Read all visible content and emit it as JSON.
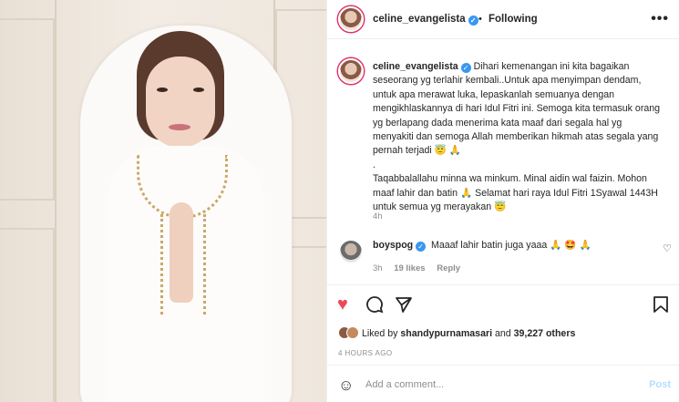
{
  "header": {
    "username": "celine_evangelista",
    "separator": "•",
    "follow_state": "Following",
    "more": "•••"
  },
  "caption": {
    "username": "celine_evangelista",
    "lines": [
      "Dihari kemenangan ini kita bagaikan",
      "seseorang yg terlahir kembali..Untuk apa menyimpan dendam,",
      "untuk apa merawat luka, lepaskanlah semuanya dengan",
      "mengikhlaskannya di hari Idul Fitri ini. Semoga kita termasuk orang",
      "yg berlapang dada menerima kata maaf dari segala hal yg",
      "menyakiti dan semoga Allah memberikan hikmah atas segala yang",
      "pernah terjadi 😇 🙏",
      ".",
      "Taqabbalallahu minna wa minkum. Minal aidin wal faizin. Mohon",
      "maaf lahir dan batin 🙏 Selamat hari raya Idul Fitri 1Syawal 1443H",
      "untuk semua yg merayakan 😇"
    ],
    "time": "4h"
  },
  "comment": {
    "username": "boyspog",
    "text": "Maaaf lahir batin juga yaaa 🙏 🤩 🙏",
    "time": "3h",
    "likes": "19 likes",
    "reply": "Reply"
  },
  "actions": {
    "liked_prefix": "Liked by ",
    "liked_user": "shandypurnamasari",
    "liked_mid": " and ",
    "liked_count": "39,227 others",
    "timestamp": "4 HOURS AGO"
  },
  "add_comment": {
    "placeholder": "Add a comment...",
    "post": "Post"
  },
  "colors": {
    "heart_red": "#ed4956",
    "verified_blue": "#3897f0",
    "post_disabled": "#b2dffc"
  }
}
